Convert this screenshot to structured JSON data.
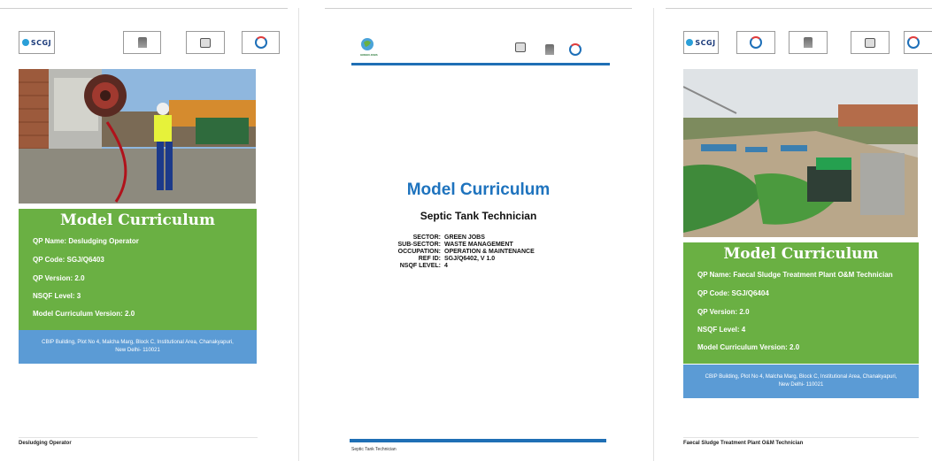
{
  "left_page": {
    "logos": [
      "SCGJ",
      "emblem-logo",
      "skill-india-logo",
      "nsdc-logo"
    ],
    "logo_text": "SCGJ",
    "title": "Model Curriculum",
    "qp_name": "QP Name: Desludging Operator",
    "qp_code": "QP Code: SGJ/Q6403",
    "qp_version": "QP Version: 2.0",
    "nsqf_level": "NSQF Level: 3",
    "mc_version": "Model Curriculum Version: 2.0",
    "address_line1": "CBIP Building, Plot No 4, Malcha Marg, Block C, Institutional Area, Chanakyapuri,",
    "address_line2": "New Delhi- 110021",
    "footer": "Desludging Operator"
  },
  "middle_page": {
    "header_small_text": "GREEN JOBS",
    "title": "Model Curriculum",
    "subtitle": "Septic Tank Technician",
    "meta": [
      {
        "key": "SECTOR:",
        "value": "GREEN JOBS"
      },
      {
        "key": "SUB-SECTOR:",
        "value": "WASTE MANAGEMENT"
      },
      {
        "key": "OCCUPATION:",
        "value": "OPERATION & MAINTENANCE"
      },
      {
        "key": "REF ID:",
        "value": "SGJ/Q6402, V 1.0"
      },
      {
        "key": "NSQF LEVEL:",
        "value": "4"
      }
    ],
    "footer": "Septic Tank Technician"
  },
  "right_page": {
    "logo_text": "SCGJ",
    "title": "Model Curriculum",
    "qp_name": "QP Name: Faecal Sludge Treatment Plant O&M Technician",
    "qp_code": "QP Code: SGJ/Q6404",
    "qp_version": "QP Version: 2.0",
    "nsqf_level": "NSQF Level: 4",
    "mc_version": "Model Curriculum Version: 2.0",
    "address_line1": "CBIP Building, Plot No 4, Malcha Marg, Block C, Institutional Area, Chanakyapuri,",
    "address_line2": "New Delhi- 110021",
    "footer": "Faecal Sludge Treatment Plant O&M Technician"
  },
  "colors": {
    "green_panel": "#6ab043",
    "blue_panel": "#5b9bd5",
    "title_blue": "#1e73be",
    "bar_blue": "#1f6fb5"
  }
}
